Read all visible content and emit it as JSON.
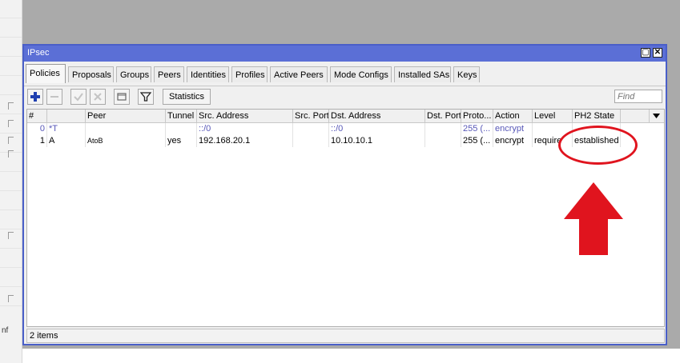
{
  "window": {
    "title": "IPsec"
  },
  "left_strip": {
    "text": "nf"
  },
  "tabs": [
    {
      "label": "Policies",
      "active": true
    },
    {
      "label": "Proposals"
    },
    {
      "label": "Groups"
    },
    {
      "label": "Peers"
    },
    {
      "label": "Identities"
    },
    {
      "label": "Profiles"
    },
    {
      "label": "Active Peers"
    },
    {
      "label": "Mode Configs"
    },
    {
      "label": "Installed SAs"
    },
    {
      "label": "Keys"
    }
  ],
  "toolbar": {
    "add_icon": "plus-icon",
    "remove_icon": "minus-icon",
    "enable_icon": "check-icon",
    "disable_icon": "x-icon",
    "comment_icon": "comment-icon",
    "filter_icon": "filter-icon",
    "statistics_label": "Statistics",
    "find_placeholder": "Find"
  },
  "columns": [
    "#",
    "Peer",
    "Tunnel",
    "Src. Address",
    "Src. Port",
    "Dst. Address",
    "Dst. Port",
    "Proto...",
    "Action",
    "Level",
    "PH2 State"
  ],
  "rows": [
    {
      "num": "0",
      "flag": "*T",
      "peer": "",
      "tunnel": "",
      "src": "::/0",
      "src_port": "",
      "dst": "::/0",
      "dst_port": "",
      "proto": "255 (...",
      "action": "encrypt",
      "level": "",
      "ph2": ""
    },
    {
      "num": "1",
      "flag": "A",
      "peer": "AtoB",
      "tunnel": "yes",
      "src": "192.168.20.1",
      "src_port": "",
      "dst": "10.10.10.1",
      "dst_port": "",
      "proto": "255 (...",
      "action": "encrypt",
      "level": "require",
      "ph2": "established"
    }
  ],
  "status": {
    "items": "2 items"
  },
  "colors": {
    "title_bar": "#5b6fd6",
    "dynamic_text": "#5858b8",
    "annotation": "#e0141e"
  }
}
